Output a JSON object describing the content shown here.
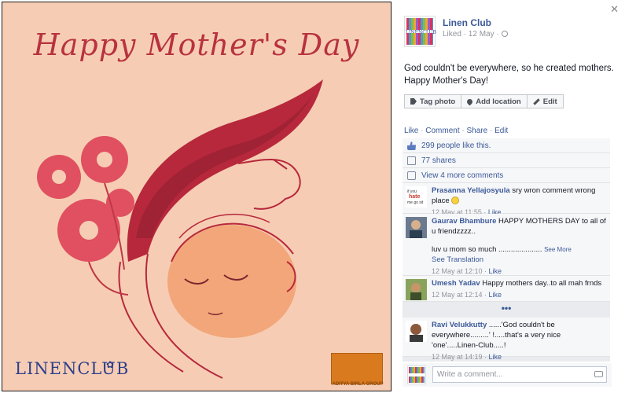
{
  "photo": {
    "title": "Happy Mother's Day",
    "brand": "LINENCLUB",
    "partner": "ADITYA BIRLA GROUP"
  },
  "post": {
    "page_name": "Linen Club",
    "meta": "Liked · 12 May ·",
    "avatar_text": "LINENCLUB",
    "text_line1": "God couldn't be everywhere, so he created mothers.",
    "text_line2": "Happy Mother's Day!",
    "actions": {
      "tag": "Tag photo",
      "location": "Add location",
      "edit": "Edit"
    },
    "links": {
      "like": "Like",
      "comment": "Comment",
      "share": "Share",
      "edit": "Edit"
    }
  },
  "ufi": {
    "likes": "299 people like this.",
    "shares": "77 shares",
    "view_more": "View 4 more comments"
  },
  "comments": [
    {
      "name": "Prasanna Yellajosyula",
      "text": "sry wron comment wrong place",
      "time": "12 May at 11:55",
      "like": "Like",
      "avatar_text": "if you hate me go sit on a cactus"
    },
    {
      "name": "Gaurav Bhambure",
      "text": "HAPPY MOTHERS DAY to all of u friendzzzz..",
      "text2": "luv u mom so much .....................",
      "see_more": "See More",
      "see_translation": "See Translation",
      "time": "12 May at 12:10",
      "like": "Like"
    },
    {
      "name": "Umesh Yadav",
      "text": "Happy mothers day..to all mah frnds",
      "time": "12 May at 12:14",
      "like": "Like"
    },
    {
      "name": "Ravi Velukkutty",
      "text": "......'God couldn't be everywhere.........' !.....that's a very nice 'one'.....Linen-Club.....!",
      "time": "12 May at 14:19",
      "like": "Like"
    }
  ],
  "more_indicator": "•••",
  "compose": {
    "placeholder": "Write a comment..."
  },
  "colors": {
    "link": "#3b5998",
    "photo_bg": "#f6cdb4",
    "accent": "#b8323f"
  }
}
